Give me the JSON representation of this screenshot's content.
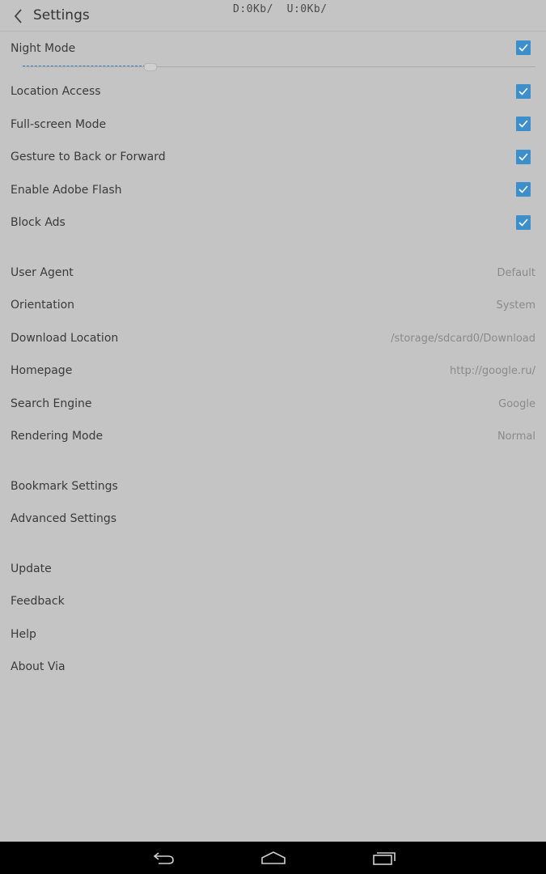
{
  "header": {
    "title": "Settings",
    "netspeed": "D:0Kb/  U:0Kb/"
  },
  "toggles": [
    {
      "label": "Night Mode",
      "checked": true
    },
    {
      "label": "Location Access",
      "checked": true
    },
    {
      "label": "Full-screen Mode",
      "checked": true
    },
    {
      "label": "Gesture to Back or Forward",
      "checked": true
    },
    {
      "label": "Enable Adobe Flash",
      "checked": true
    },
    {
      "label": "Block Ads",
      "checked": true
    }
  ],
  "night_mode_brightness": 0.24,
  "options": [
    {
      "label": "User Agent",
      "value": "Default"
    },
    {
      "label": "Orientation",
      "value": "System"
    },
    {
      "label": "Download Location",
      "value": "/storage/sdcard0/Download"
    },
    {
      "label": "Homepage",
      "value": "http://google.ru/"
    },
    {
      "label": "Search Engine",
      "value": "Google"
    },
    {
      "label": "Rendering Mode",
      "value": "Normal"
    }
  ],
  "more_settings": [
    {
      "label": "Bookmark Settings"
    },
    {
      "label": "Advanced Settings"
    }
  ],
  "about": [
    {
      "label": "Update"
    },
    {
      "label": "Feedback"
    },
    {
      "label": "Help"
    },
    {
      "label": "About Via"
    }
  ],
  "colors": {
    "background": "#c4c4c4",
    "checkbox": "#3d8fcc",
    "navbar": "#000000"
  },
  "icons": {
    "back": "chevron-left-icon",
    "nav_back": "back-arrow-icon",
    "nav_home": "home-icon",
    "nav_recents": "recent-apps-icon"
  }
}
